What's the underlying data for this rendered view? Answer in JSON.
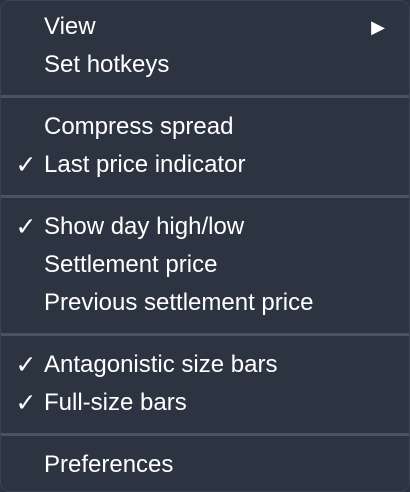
{
  "menu": {
    "groups": [
      {
        "items": [
          {
            "label": "View",
            "checked": false,
            "submenu_arrow": "▶"
          },
          {
            "label": "Set hotkeys",
            "checked": false
          }
        ]
      },
      {
        "items": [
          {
            "label": "Compress spread",
            "checked": false
          },
          {
            "label": "Last price indicator",
            "checked": true
          }
        ]
      },
      {
        "items": [
          {
            "label": "Show day high/low",
            "checked": true
          },
          {
            "label": "Settlement price",
            "checked": false
          },
          {
            "label": "Previous settlement price",
            "checked": false
          }
        ]
      },
      {
        "items": [
          {
            "label": "Antagonistic size bars",
            "checked": true
          },
          {
            "label": "Full-size bars",
            "checked": true
          }
        ]
      },
      {
        "items": [
          {
            "label": "Preferences",
            "checked": false
          }
        ]
      }
    ],
    "check_glyph": "✓",
    "colors": {
      "background": "#2c3442",
      "separator": "#4a5364",
      "text": "#ffffff"
    }
  }
}
